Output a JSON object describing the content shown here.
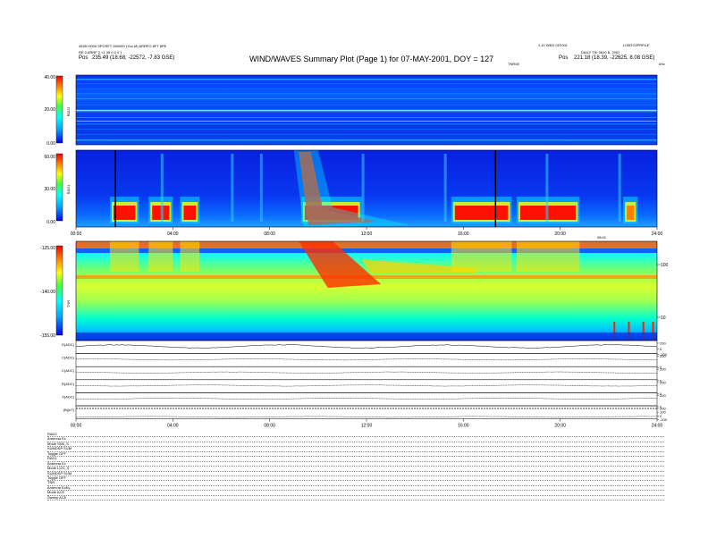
{
  "header": {
    "title": "WIND/WAVES Summary Plot (Page 1) for 07-MAY-2001, DOY = 127",
    "top_left_line1": "4535+0000 SPCRFT 050000 (You M)  ARRFO 8FT 8PE",
    "top_left_line2": "RE 0 ARRF 2 =1 35 0 0 0 1",
    "top_left_pos_label": "Pos",
    "top_left_pos_value": "235.49 (18.68, -22572, -7.83 GSE)",
    "top_right_line1": "1.10 WED 01F001",
    "top_right_corner": "LOBTC0PRFILE",
    "top_right_line2": "DAILY TSI 0810 B, 2002",
    "top_right_pos_label": "Pos",
    "top_right_pos_value": "221.18 (18.39, -22625, 8.08 GSE)",
    "tnr_label": "TNR0E",
    "khz_label": "kHz"
  },
  "chart_data": [
    {
      "type": "heatmap",
      "title": "RAD2",
      "ylabel": "RAD2",
      "yticks": [
        "40.00",
        "20.00",
        "0.00"
      ],
      "ylim": [
        0,
        40
      ],
      "xlim_hours": [
        0,
        24
      ],
      "colorscale": [
        "#0000ff",
        "#00b0ff",
        "#00ffff",
        "#00ff80",
        "#ffff00",
        "#ff8000",
        "#ff0000"
      ]
    },
    {
      "type": "heatmap",
      "title": "RAD1",
      "ylabel": "RAD1",
      "yticks": [
        "60.00",
        "30.00",
        "0.00"
      ],
      "ylim": [
        0,
        60
      ],
      "xticks": [
        "00:00",
        "04:00",
        "08:00",
        "12:00",
        "16:00",
        "20:00",
        "24:00"
      ],
      "xlim_hours": [
        0,
        24
      ],
      "events": [
        {
          "start_h": 1.4,
          "end_h": 2.6,
          "level": "high"
        },
        {
          "start_h": 3.0,
          "end_h": 4.0,
          "level": "high"
        },
        {
          "start_h": 4.3,
          "end_h": 5.1,
          "level": "high"
        },
        {
          "start_h": 9.3,
          "end_h": 11.8,
          "level": "high"
        },
        {
          "start_h": 15.5,
          "end_h": 18.0,
          "level": "high"
        },
        {
          "start_h": 18.2,
          "end_h": 20.8,
          "level": "high"
        },
        {
          "start_h": 22.6,
          "end_h": 23.2,
          "level": "medium"
        }
      ]
    },
    {
      "type": "heatmap",
      "title": "TNR",
      "ylabel": "TNR",
      "yticks": [
        "-125.00",
        "-140.00",
        "-155.00"
      ],
      "ylim": [
        -155,
        -125
      ],
      "right_ticks": [
        "100",
        "10"
      ],
      "right_label": "kHz",
      "top_right_label": "08:01",
      "xlim_hours": [
        0,
        24
      ]
    },
    {
      "type": "line",
      "title": "Housekeeping",
      "xticks": [
        "00:00",
        "04:00",
        "08:00",
        "12:00",
        "16:00",
        "20:00",
        "24:00"
      ],
      "xlim_hours": [
        0,
        24
      ],
      "series": [
        {
          "name": "E(ADC)",
          "right_ticks": [
            "200",
            "0",
            "-200"
          ]
        },
        {
          "name": "C(ADC)",
          "right_ticks": [
            "200",
            "0"
          ]
        },
        {
          "name": "C(ADC)",
          "right_ticks": [
            "200",
            "0"
          ]
        },
        {
          "name": "R(ADC)",
          "right_ticks": [
            "200",
            "0"
          ]
        },
        {
          "name": "X(ADC)",
          "right_ticks": [
            "200",
            "0"
          ]
        },
        {
          "name": "|B|(nT)",
          "right_ticks": [
            "200",
            "100",
            "0",
            "-100"
          ]
        }
      ]
    }
  ],
  "footer": {
    "lines": [
      "RAD2",
      "Antenna  Ex",
      "Mode  SN5_S",
      "SUMDSP  SUM",
      "Toggle  OFF",
      "RAD1",
      "Antenna  Ex",
      "Mode  LOG_S",
      "SUMDSP  SUM",
      "Toggle  OFF",
      "TNR",
      "Antenna  ExEy",
      "Mode  ACE",
      "Sweep  ACE"
    ]
  }
}
